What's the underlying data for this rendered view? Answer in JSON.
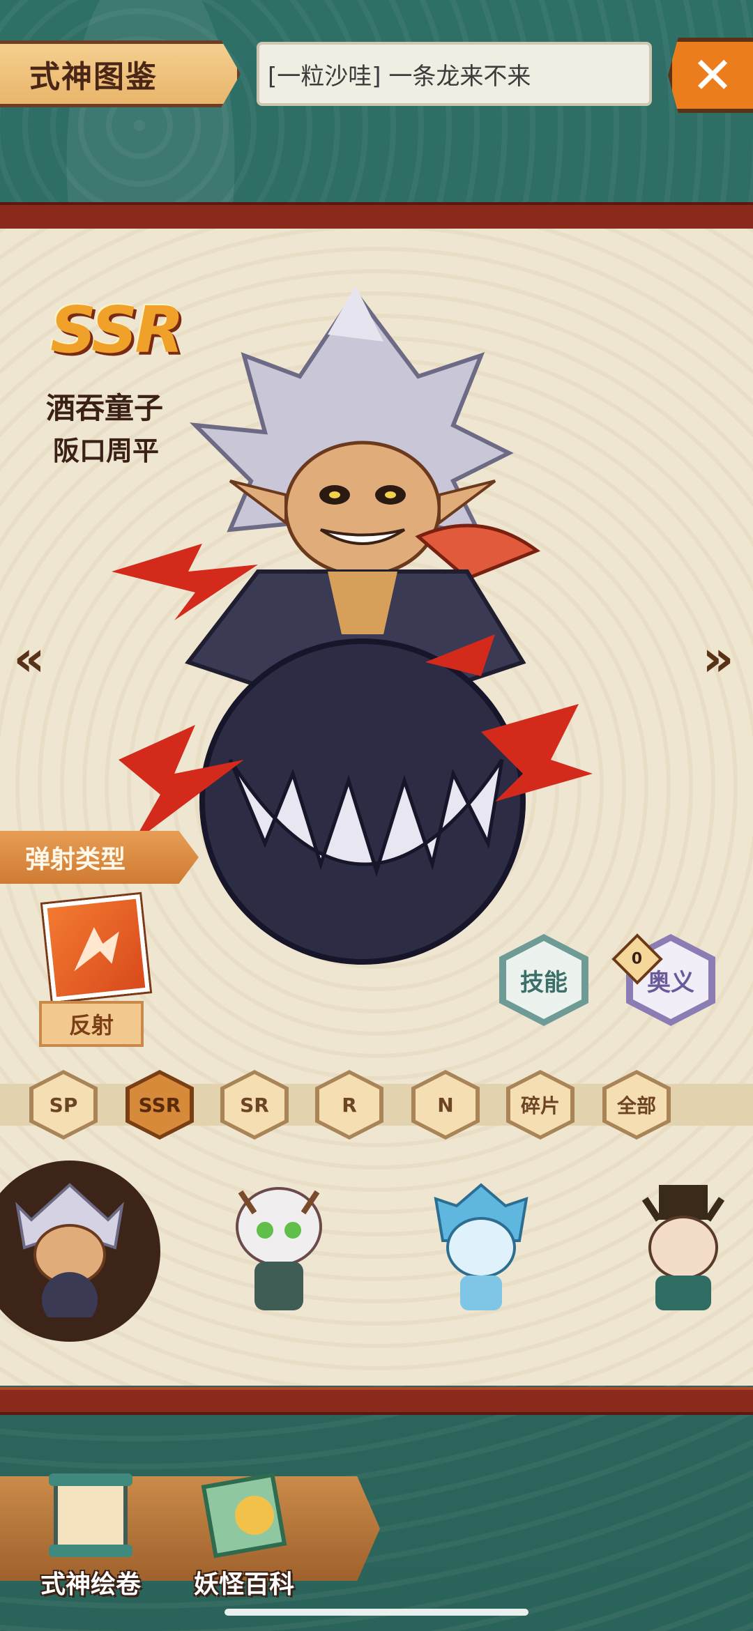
{
  "header": {
    "title": "式神图鉴",
    "announcement": "[一粒沙哇] 一条龙来不来",
    "close_label": "✕"
  },
  "character": {
    "rarity": "SSR",
    "name": "酒吞童子",
    "voice_actor": "阪口周平"
  },
  "navigation": {
    "prev_label": "«",
    "next_label": "»"
  },
  "type_section": {
    "title": "弹射类型",
    "type_label": "反射"
  },
  "actions": {
    "skill_label": "技能",
    "ougi_label": "奥义",
    "ougi_badge": "0"
  },
  "filters": [
    "SP",
    "SSR",
    "SR",
    "R",
    "N",
    "碎片",
    "全部"
  ],
  "active_filter": "SSR",
  "bottom_nav": {
    "item1": "式神绘卷",
    "item2": "妖怪百科"
  },
  "colors": {
    "accent_orange": "#ec7d1d",
    "panel_red": "#8a2a1c",
    "teal_background": "#2f6d63"
  }
}
